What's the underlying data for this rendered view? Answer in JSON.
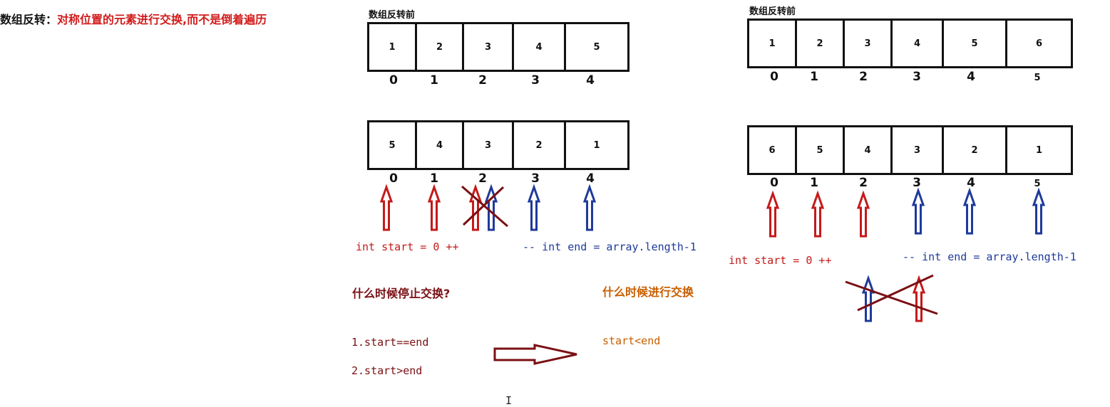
{
  "heading": {
    "label": "数组反转：",
    "text": "对称位置的元素进行交换,而不是倒着遍历"
  },
  "left": {
    "title": "数组反转前",
    "before": {
      "values": [
        "1",
        "2",
        "3",
        "4",
        "5"
      ],
      "indices": [
        "0",
        "1",
        "2",
        "3",
        "4"
      ]
    },
    "after": {
      "values": [
        "5",
        "4",
        "3",
        "2",
        "1"
      ],
      "indices": [
        "0",
        "1",
        "2",
        "3",
        "4"
      ]
    },
    "start_label": "int start = 0 ++",
    "end_label": "-- int end = array.length-1",
    "stop_question": "什么时候停止交换?",
    "swap_question": "什么时候进行交换",
    "cond1": "1.start==end",
    "cond2": "2.start>end",
    "swap_cond": "start<end"
  },
  "right": {
    "title": "数组反转前",
    "before": {
      "values": [
        "1",
        "2",
        "3",
        "4",
        "5",
        "6"
      ],
      "indices": [
        "0",
        "1",
        "2",
        "3",
        "4",
        "5"
      ]
    },
    "after": {
      "values": [
        "6",
        "5",
        "4",
        "3",
        "2",
        "1"
      ],
      "indices": [
        "0",
        "1",
        "2",
        "3",
        "4",
        "5"
      ]
    },
    "start_label": "int start = 0 ++",
    "end_label": "-- int end = array.length-1"
  },
  "cursor": "I",
  "colors": {
    "red": "#c41a1a",
    "blue": "#1f3a9a",
    "darkred": "#7a1014",
    "orange": "#c85f00"
  }
}
